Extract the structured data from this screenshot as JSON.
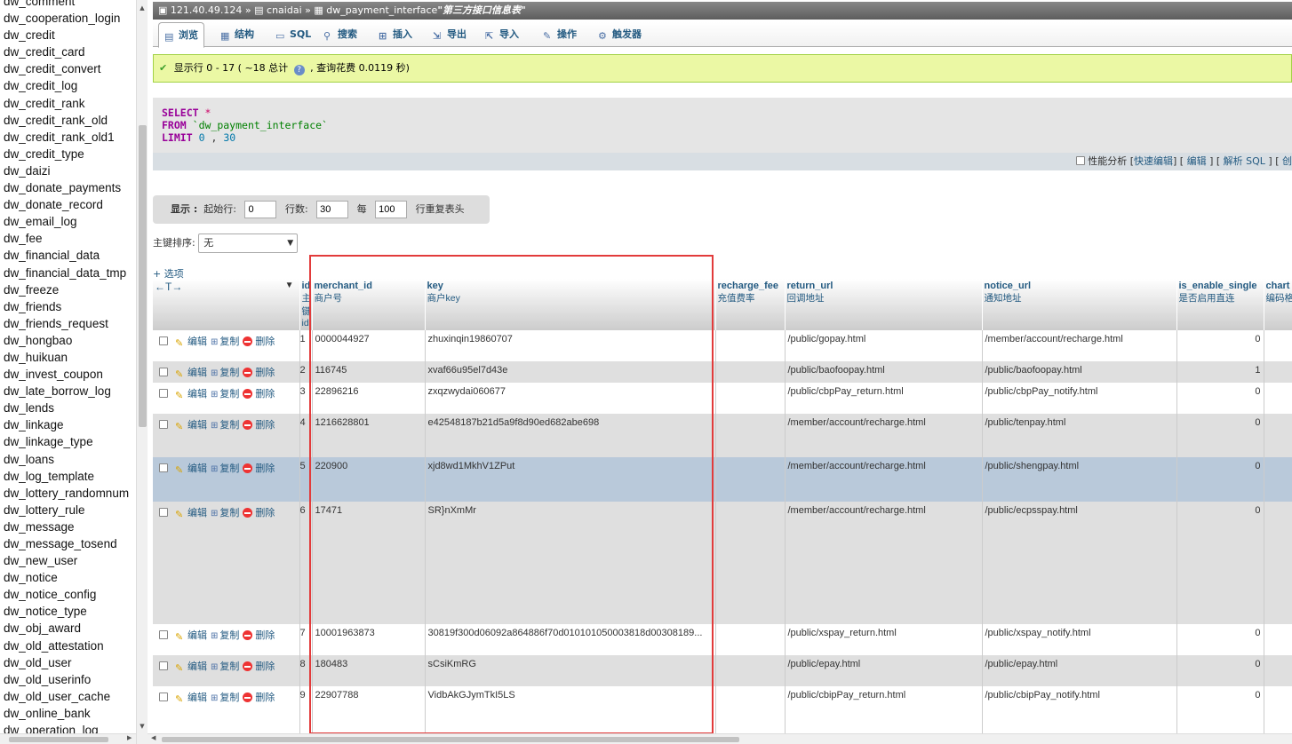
{
  "sidebar": {
    "tables": [
      "dw_comment",
      "dw_cooperation_login",
      "dw_credit",
      "dw_credit_card",
      "dw_credit_convert",
      "dw_credit_log",
      "dw_credit_rank",
      "dw_credit_rank_old",
      "dw_credit_rank_old1",
      "dw_credit_type",
      "dw_daizi",
      "dw_donate_payments",
      "dw_donate_record",
      "dw_email_log",
      "dw_fee",
      "dw_financial_data",
      "dw_financial_data_tmp",
      "dw_freeze",
      "dw_friends",
      "dw_friends_request",
      "dw_hongbao",
      "dw_huikuan",
      "dw_invest_coupon",
      "dw_late_borrow_log",
      "dw_lends",
      "dw_linkage",
      "dw_linkage_type",
      "dw_loans",
      "dw_log_template",
      "dw_lottery_randomnum",
      "dw_lottery_rule",
      "dw_message",
      "dw_message_tosend",
      "dw_new_user",
      "dw_notice",
      "dw_notice_config",
      "dw_notice_type",
      "dw_obj_award",
      "dw_old_attestation",
      "dw_old_user",
      "dw_old_userinfo",
      "dw_old_user_cache",
      "dw_online_bank",
      "dw_operation_log"
    ]
  },
  "breadcrumb": {
    "server": "121.40.49.124",
    "sep": "»",
    "database": "cnaidai",
    "table": "dw_payment_interface",
    "table_comment": "\"第三方接口信息表\""
  },
  "tabs": [
    {
      "label": "浏览",
      "icon": "browse-icon"
    },
    {
      "label": "结构",
      "icon": "structure-icon"
    },
    {
      "label": "SQL",
      "icon": "sql-icon"
    },
    {
      "label": "搜索",
      "icon": "search-icon"
    },
    {
      "label": "插入",
      "icon": "insert-icon"
    },
    {
      "label": "导出",
      "icon": "export-icon"
    },
    {
      "label": "导入",
      "icon": "import-icon"
    },
    {
      "label": "操作",
      "icon": "operations-icon"
    },
    {
      "label": "触发器",
      "icon": "triggers-icon"
    }
  ],
  "notice": {
    "text_a": "显示行 0 - 17 ( ~18 总计",
    "text_b": ", 查询花费 0.0119 秒)"
  },
  "sql": {
    "select": "SELECT",
    "star": "*",
    "from": "FROM",
    "table": "`dw_payment_interface`",
    "limit": "LIMIT",
    "offset": "0",
    "comma": ",",
    "count": "30"
  },
  "sqlbar": {
    "profiling": "性能分析",
    "inline_edit": "快速编辑",
    "edit": "编辑",
    "explain": "解析 SQL",
    "create": "创"
  },
  "display": {
    "label": "显示 :",
    "start_label": "起始行:",
    "start_value": "0",
    "rows_label": "行数:",
    "rows_value": "30",
    "every_label": "每",
    "every_value": "100",
    "repeat_label": "行重复表头"
  },
  "sort": {
    "label": "主键排序:",
    "value": "无"
  },
  "options_link": "+ 选项",
  "columns": [
    {
      "name": "id",
      "comment": "主键id"
    },
    {
      "name": "merchant_id",
      "comment": "商户号"
    },
    {
      "name": "key",
      "comment": "商户key"
    },
    {
      "name": "recharge_fee",
      "comment": "充值费率"
    },
    {
      "name": "return_url",
      "comment": "回调地址"
    },
    {
      "name": "notice_url",
      "comment": "通知地址"
    },
    {
      "name": "is_enable_single",
      "comment": "是否启用直连"
    },
    {
      "name": "chart",
      "comment": "编码格"
    }
  ],
  "row_actions": {
    "edit": "编辑",
    "copy": "复制",
    "delete": "删除",
    "arrows": "←T→"
  },
  "rows": [
    {
      "id": "1",
      "merchant_id": "0000044927",
      "key": "zhuxinqin19860707",
      "recharge_fee": "",
      "return_url": "/public/gopay.html",
      "notice_url": "/member/account/recharge.html",
      "is_enable_single": "0"
    },
    {
      "id": "2",
      "merchant_id": "116745",
      "key": "xvaf66u95el7d43e",
      "recharge_fee": "",
      "return_url": "/public/baofoopay.html",
      "notice_url": "/public/baofoopay.html",
      "is_enable_single": "1"
    },
    {
      "id": "3",
      "merchant_id": "22896216",
      "key": "zxqzwydai060677",
      "recharge_fee": "",
      "return_url": "/public/cbpPay_return.html",
      "notice_url": "/public/cbpPay_notify.html",
      "is_enable_single": "0"
    },
    {
      "id": "4",
      "merchant_id": "1216628801",
      "key": "e42548187b21d5a9f8d90ed682abe698",
      "recharge_fee": "",
      "return_url": "/member/account/recharge.html",
      "notice_url": "/public/tenpay.html",
      "is_enable_single": "0"
    },
    {
      "id": "5",
      "merchant_id": "220900",
      "key": "xjd8wd1MkhV1ZPut",
      "recharge_fee": "",
      "return_url": "/member/account/recharge.html",
      "notice_url": "/public/shengpay.html",
      "is_enable_single": "0"
    },
    {
      "id": "6",
      "merchant_id": "17471",
      "key": "SR}nXmMr",
      "recharge_fee": "",
      "return_url": "/member/account/recharge.html",
      "notice_url": "/public/ecpsspay.html",
      "is_enable_single": "0"
    },
    {
      "id": "7",
      "merchant_id": "10001963873",
      "key": "30819f300d06092a864886f70d010101050003818d00308189...",
      "recharge_fee": "",
      "return_url": "/public/xspay_return.html",
      "notice_url": "/public/xspay_notify.html",
      "is_enable_single": "0"
    },
    {
      "id": "8",
      "merchant_id": "180483",
      "key": "sCsiKmRG",
      "recharge_fee": "",
      "return_url": "/public/epay.html",
      "notice_url": "/public/epay.html",
      "is_enable_single": "0"
    },
    {
      "id": "9",
      "merchant_id": "22907788",
      "key": "VidbAkGJymTkI5LS",
      "recharge_fee": "",
      "return_url": "/public/cbipPay_return.html",
      "notice_url": "/public/cbipPay_notify.html",
      "is_enable_single": "0"
    }
  ]
}
